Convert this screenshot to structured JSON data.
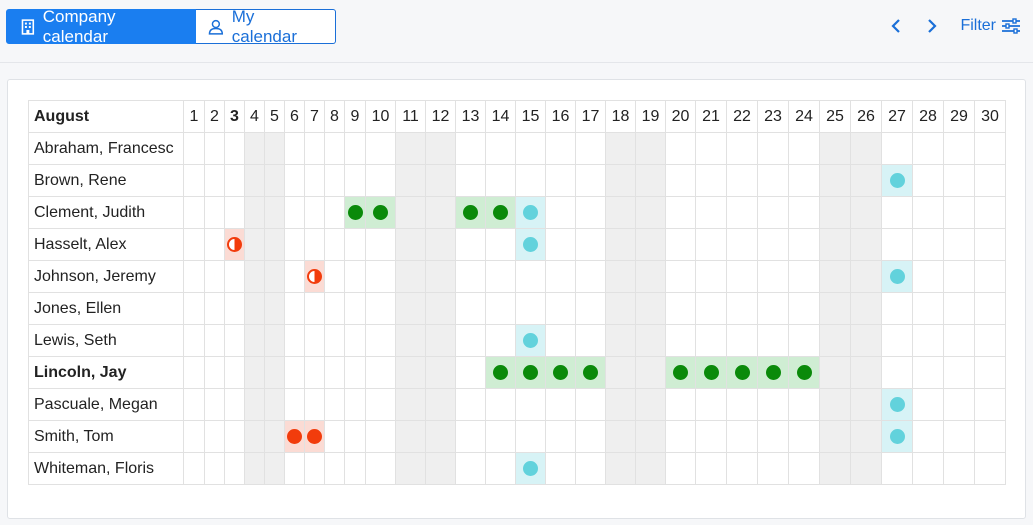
{
  "toolbar": {
    "company_label": "Company calendar",
    "my_label": "My calendar",
    "filter_label": "Filter"
  },
  "calendar": {
    "month": "August",
    "today": 3,
    "days": [
      1,
      2,
      3,
      4,
      5,
      6,
      7,
      8,
      9,
      10,
      11,
      12,
      13,
      14,
      15,
      16,
      17,
      18,
      19,
      20,
      21,
      22,
      23,
      24,
      25,
      26,
      27,
      28,
      29,
      30
    ],
    "weekend_days": [
      4,
      5,
      11,
      12,
      18,
      19,
      25,
      26
    ],
    "people": [
      {
        "name": "Abraham, Francesc",
        "bold": false,
        "absences": []
      },
      {
        "name": "Brown, Rene",
        "bold": false,
        "absences": [
          {
            "day": 27,
            "type": "holiday"
          }
        ]
      },
      {
        "name": "Clement, Judith",
        "bold": false,
        "absences": [
          {
            "day": 9,
            "type": "vacation"
          },
          {
            "day": 10,
            "type": "vacation"
          },
          {
            "day": 13,
            "type": "vacation"
          },
          {
            "day": 14,
            "type": "vacation"
          },
          {
            "day": 15,
            "type": "holiday"
          }
        ]
      },
      {
        "name": "Hasselt, Alex",
        "bold": false,
        "absences": [
          {
            "day": 3,
            "type": "sick-half"
          },
          {
            "day": 15,
            "type": "holiday"
          }
        ]
      },
      {
        "name": "Johnson, Jeremy",
        "bold": false,
        "absences": [
          {
            "day": 7,
            "type": "sick-half"
          },
          {
            "day": 27,
            "type": "holiday"
          }
        ]
      },
      {
        "name": "Jones, Ellen",
        "bold": false,
        "absences": []
      },
      {
        "name": "Lewis, Seth",
        "bold": false,
        "absences": [
          {
            "day": 15,
            "type": "holiday"
          }
        ]
      },
      {
        "name": "Lincoln, Jay",
        "bold": true,
        "absences": [
          {
            "day": 14,
            "type": "vacation"
          },
          {
            "day": 15,
            "type": "vacation"
          },
          {
            "day": 16,
            "type": "vacation"
          },
          {
            "day": 17,
            "type": "vacation"
          },
          {
            "day": 20,
            "type": "vacation"
          },
          {
            "day": 21,
            "type": "vacation"
          },
          {
            "day": 22,
            "type": "vacation"
          },
          {
            "day": 23,
            "type": "vacation"
          },
          {
            "day": 24,
            "type": "vacation"
          }
        ]
      },
      {
        "name": "Pascuale, Megan",
        "bold": false,
        "absences": [
          {
            "day": 27,
            "type": "holiday"
          }
        ]
      },
      {
        "name": "Smith, Tom",
        "bold": false,
        "absences": [
          {
            "day": 6,
            "type": "sick"
          },
          {
            "day": 7,
            "type": "sick"
          },
          {
            "day": 27,
            "type": "holiday"
          }
        ]
      },
      {
        "name": "Whiteman, Floris",
        "bold": false,
        "absences": [
          {
            "day": 15,
            "type": "holiday"
          }
        ]
      }
    ]
  },
  "colors": {
    "accent": "#1a7ef0",
    "vacation": "#0a8a0a",
    "holiday": "#62d2dc",
    "sick": "#f23c0c",
    "weekend": "#efefef"
  }
}
